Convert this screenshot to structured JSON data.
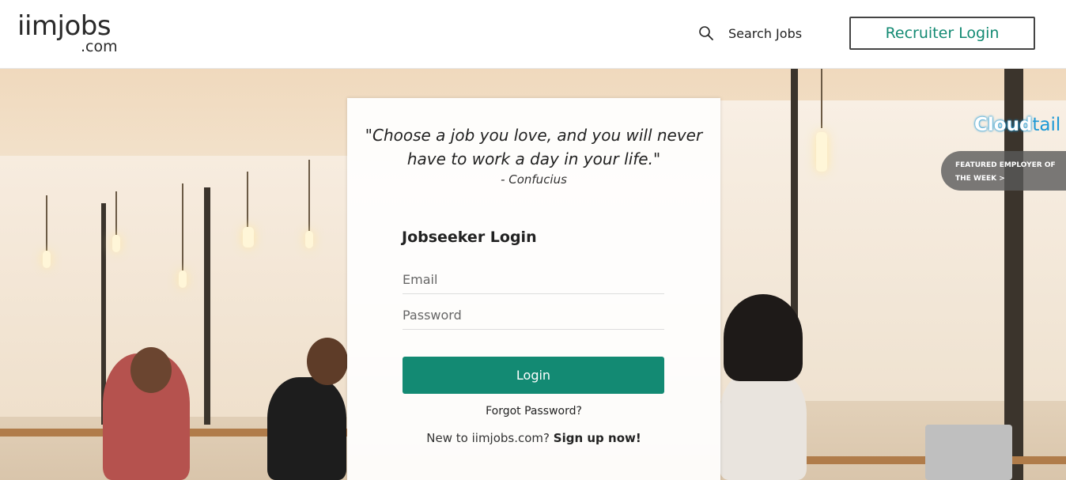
{
  "header": {
    "logo_main": "iimjobs",
    "logo_sub": ".com",
    "search_label": "Search Jobs",
    "recruiter_login_label": "Recruiter Login"
  },
  "featured": {
    "brand_logo_text": "Cloudtail",
    "label_line1": "FEATURED EMPLOYER OF",
    "label_line2": "THE WEEK >"
  },
  "login_card": {
    "quote_line1": "\"Choose a job you love, and you will never",
    "quote_line2": "have to work a day in your life.\"",
    "author": "- Confucius",
    "title": "Jobseeker Login",
    "email_placeholder": "Email",
    "password_placeholder": "Password",
    "login_button": "Login",
    "forgot_password": "Forgot Password?",
    "signup_prefix": "New to iimjobs.com?",
    "signup_link": "Sign up now!"
  },
  "colors": {
    "brand_green": "#138a73",
    "cloudtail_blue": "#1b98d6"
  },
  "icons": {
    "search": "search-icon"
  }
}
